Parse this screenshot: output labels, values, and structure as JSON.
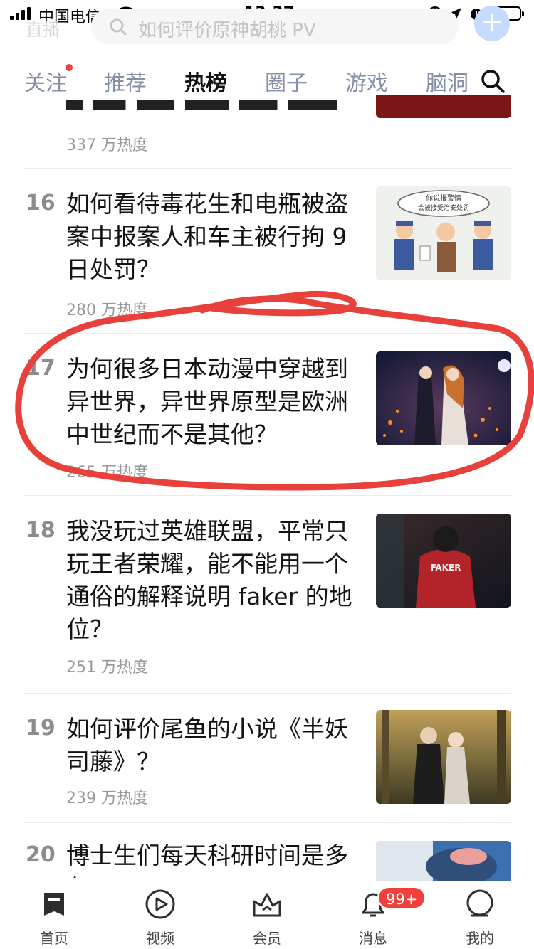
{
  "status_bar": {
    "carrier": "中国电信",
    "time": "13:37",
    "battery_level": 0.15
  },
  "header": {
    "live_label": "直播",
    "search_placeholder": "如何评价原神胡桃 PV"
  },
  "tabs": [
    {
      "label": "关注",
      "active": false,
      "has_dot": true
    },
    {
      "label": "推荐",
      "active": false
    },
    {
      "label": "热榜",
      "active": true
    },
    {
      "label": "圈子",
      "active": false
    },
    {
      "label": "游戏",
      "active": false
    },
    {
      "label": "脑洞",
      "active": false
    }
  ],
  "list": {
    "partial_top_item": {
      "heat": "337 万热度"
    },
    "items": [
      {
        "rank": "16",
        "title": "如何看待毒花生和电瓶被盗案中报案人和车主被行拘 9 日处罚？",
        "heat": "280 万热度",
        "thumb_caption_1": "你说报警情",
        "thumb_caption_2": "会被接受治安处罚"
      },
      {
        "rank": "17",
        "title": "为何很多日本动漫中穿越到异世界，异世界原型是欧洲中世纪而不是其他？",
        "heat": "265 万热度"
      },
      {
        "rank": "18",
        "title": "我没玩过英雄联盟，平常只玩王者荣耀，能不能用一个通俗的解释说明 faker 的地位？",
        "heat": "251 万热度",
        "thumb_jersey_text": "FAKER"
      },
      {
        "rank": "19",
        "title": "如何评价尾鱼的小说《半妖司藤》？",
        "heat": "239 万热度"
      },
      {
        "rank": "20",
        "title": "博士生们每天科研时间是多久？"
      }
    ]
  },
  "bottom_nav": {
    "items": [
      {
        "label": "首页",
        "icon": "home-icon"
      },
      {
        "label": "视频",
        "icon": "video-icon"
      },
      {
        "label": "会员",
        "icon": "member-crown-icon"
      },
      {
        "label": "消息",
        "icon": "bell-icon"
      },
      {
        "label": "我的",
        "icon": "profile-icon"
      }
    ],
    "message_badge": "99+"
  },
  "colors": {
    "accent_blue": "#0066ff",
    "annotation_red": "#e8413c",
    "badge_red": "#f1403c",
    "secondary_text": "#999999"
  }
}
